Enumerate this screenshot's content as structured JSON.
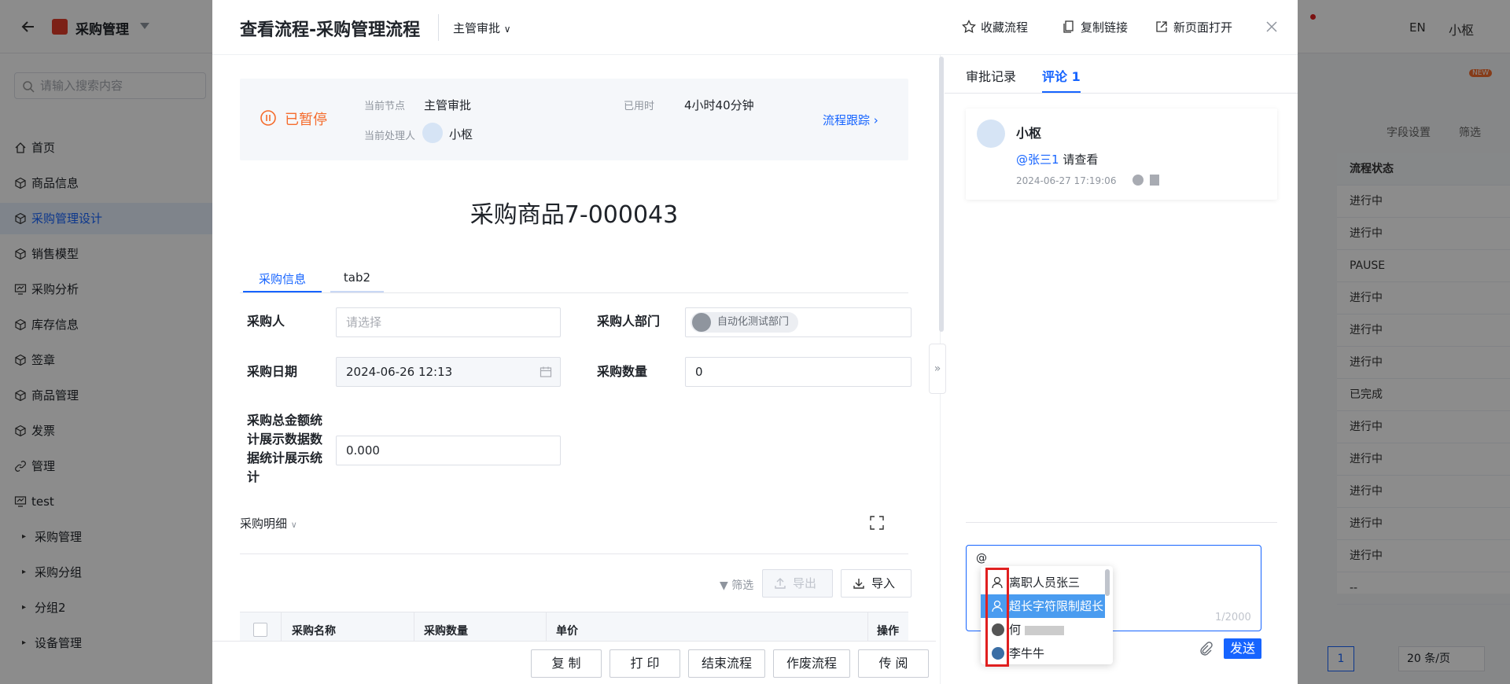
{
  "app": {
    "title": "采购管理",
    "search_placeholder": "请输入搜索内容",
    "lang": "EN",
    "user": "小枢",
    "new_badge": "NEW",
    "field_settings": "字段设置",
    "filter": "筛选",
    "status_header": "流程状态",
    "status_rows": [
      "进行中",
      "进行中",
      "PAUSE",
      "进行中",
      "进行中",
      "进行中",
      "已完成",
      "进行中",
      "进行中",
      "进行中",
      "进行中",
      "进行中",
      "--"
    ],
    "pagination": {
      "page": "1",
      "page_size": "20 条/页"
    },
    "nav": [
      {
        "label": "首页",
        "icon": "home-icon"
      },
      {
        "label": "商品信息",
        "icon": "cube-icon"
      },
      {
        "label": "采购管理设计",
        "icon": "cube-icon",
        "active": true
      },
      {
        "label": "销售模型",
        "icon": "cube-icon"
      },
      {
        "label": "采购分析",
        "icon": "chart-icon"
      },
      {
        "label": "库存信息",
        "icon": "cube-icon"
      },
      {
        "label": "签章",
        "icon": "cube-icon"
      },
      {
        "label": "商品管理",
        "icon": "cube-icon"
      },
      {
        "label": "发票",
        "icon": "cube-icon"
      },
      {
        "label": "管理",
        "icon": "link-icon"
      },
      {
        "label": "test",
        "icon": "chart-icon"
      }
    ],
    "nav_sub": [
      "采购管理",
      "采购分组",
      "分组2",
      "设备管理"
    ]
  },
  "modal": {
    "title": "查看流程-采购管理流程",
    "node_select": "主管审批",
    "header_actions": {
      "favorite": "收藏流程",
      "copy_link": "复制链接",
      "open_new": "新页面打开"
    },
    "status": {
      "state": "已暂停",
      "current_node_label": "当前节点",
      "current_node": "主管审批",
      "handler_label": "当前处理人",
      "handler": "小枢",
      "elapsed_label": "已用时",
      "elapsed": "4小时40分钟",
      "track": "流程跟踪"
    },
    "doc_title": "采购商品7-000043",
    "tabs": [
      "采购信息",
      "tab2"
    ],
    "fields": {
      "buyer_label": "采购人",
      "buyer_placeholder": "请选择",
      "dept_label": "采购人部门",
      "dept_value": "自动化测试部门",
      "date_label": "采购日期",
      "date_value": "2024-06-26 12:13",
      "qty_label": "采购数量",
      "qty_value": "0",
      "total_label": "采购总金额统计展示数据数据统计展示统计",
      "total_value": "0.000"
    },
    "detail": {
      "label": "采购明细",
      "filter": "筛选",
      "export": "导出",
      "import": "导入",
      "columns": [
        "采购名称",
        "采购数量",
        "单价",
        "操作"
      ]
    },
    "footer": [
      "复 制",
      "打 印",
      "结束流程",
      "作废流程",
      "传 阅"
    ],
    "right": {
      "tabs": [
        "审批记录",
        "评论 1"
      ],
      "comment": {
        "author": "小枢",
        "mention": "@张三1",
        "text": "请查看",
        "time": "2024-06-27 17:19:06"
      },
      "editor": {
        "value": "@",
        "counter": "1/2000",
        "send": "发送"
      },
      "mention_list": [
        "离职人员张三",
        "超长字符限制超长",
        "何",
        "李牛牛"
      ]
    }
  },
  "colors": {
    "primary": "#1664ff",
    "paused": "#f56c2d",
    "highlight_box": "#e02020"
  }
}
